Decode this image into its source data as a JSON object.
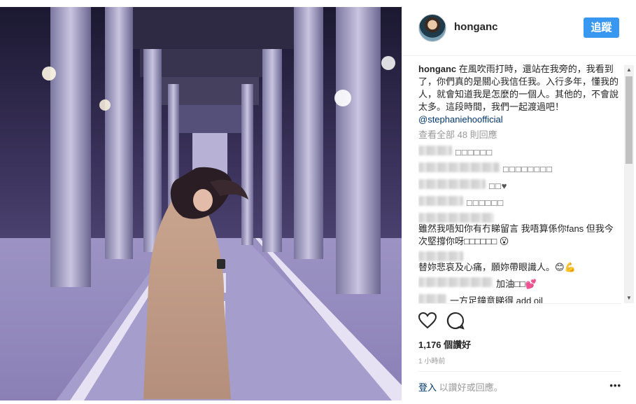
{
  "post": {
    "username": "honganc",
    "follow_label": "追蹤",
    "caption_user": "honganc",
    "caption_text": " 在風吹雨打時，還站在我旁的，我看到了，你們真的是關心我信任我。入行多年，懂我的人，就會知道我是怎麼的一個人。其他的，不會說太多。這段時間，我們一起渡過吧！",
    "caption_mention": "@stephaniehoofficial",
    "view_all": "查看全部 48 則回應",
    "comments": [
      {
        "text": "□□□□□□"
      },
      {
        "text": "□□□□□□□□"
      },
      {
        "text": "□□♥"
      },
      {
        "text": "□□□□□□"
      },
      {
        "text": "雖然我唔知你有冇睇留言 我唔算係你fans 但我今次堅撐你呀□□□□□□ 😮"
      },
      {
        "text": "替妳悲哀及心痛，願妳帶眼識人。😊💪"
      },
      {
        "text": "加油□□💕"
      },
      {
        "text": "一方足鐘意睇得 add oil"
      }
    ],
    "likes": "1,176 個讚好",
    "time": "1 小時前",
    "login_text": "登入",
    "login_suffix": " 以讚好或回應。",
    "more": "•••"
  },
  "colors": {
    "accent": "#3897f0",
    "link": "#003569",
    "muted": "#999999"
  },
  "icons": [
    "heart-icon",
    "comment-icon",
    "more-icon"
  ]
}
